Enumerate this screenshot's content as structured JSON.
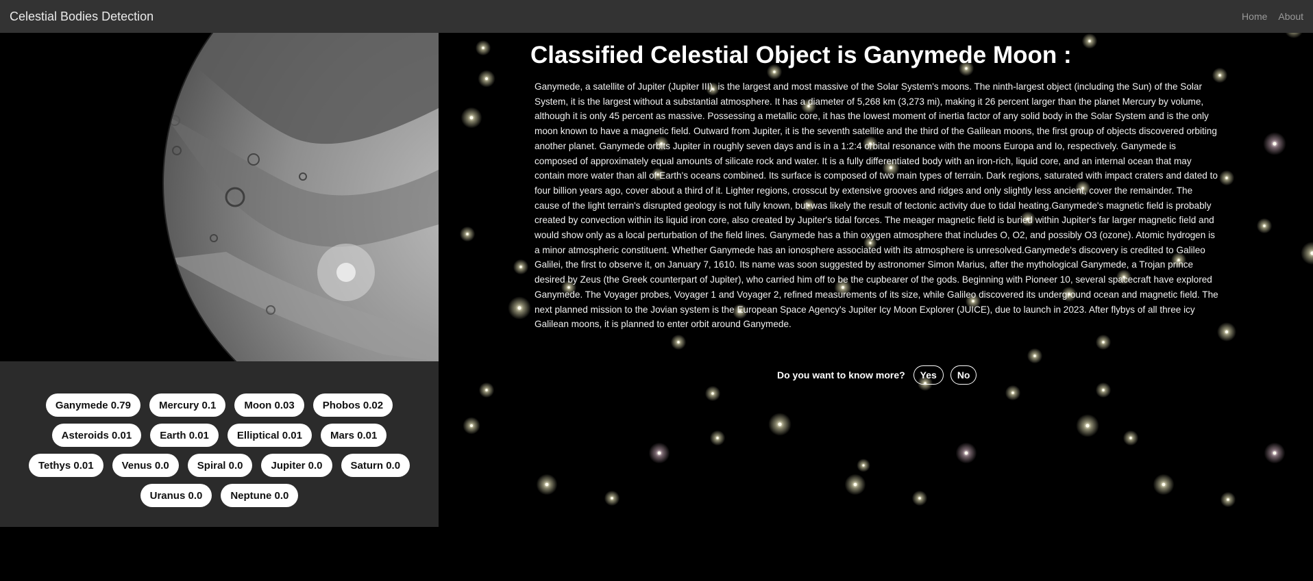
{
  "nav": {
    "brand": "Celestial Bodies Detection",
    "links": [
      "Home",
      "About"
    ]
  },
  "photo": {
    "subject": "Ganymede"
  },
  "predictions": [
    {
      "label": "Ganymede 0.79"
    },
    {
      "label": "Mercury 0.1"
    },
    {
      "label": "Moon 0.03"
    },
    {
      "label": "Phobos 0.02"
    },
    {
      "label": "Asteroids 0.01"
    },
    {
      "label": "Earth 0.01"
    },
    {
      "label": "Elliptical 0.01"
    },
    {
      "label": "Mars 0.01"
    },
    {
      "label": "Tethys 0.01"
    },
    {
      "label": "Venus 0.0"
    },
    {
      "label": "Spiral 0.0"
    },
    {
      "label": "Jupiter 0.0"
    },
    {
      "label": "Saturn 0.0"
    },
    {
      "label": "Uranus 0.0"
    },
    {
      "label": "Neptune 0.0"
    }
  ],
  "result": {
    "title": "Classified Celestial Object is Ganymede Moon :",
    "description": "Ganymede, a satellite of Jupiter (Jupiter III), is the largest and most massive of the Solar System's moons. The ninth-largest object (including the Sun) of the Solar System, it is the largest without a substantial atmosphere. It has a diameter of 5,268 km (3,273 mi), making it 26 percent larger than the planet Mercury by volume, although it is only 45 percent as massive. Possessing a metallic core, it has the lowest moment of inertia factor of any solid body in the Solar System and is the only moon known to have a magnetic field. Outward from Jupiter, it is the seventh satellite and the third of the Galilean moons, the first group of objects discovered orbiting another planet. Ganymede orbits Jupiter in roughly seven days and is in a 1:2:4 orbital resonance with the moons Europa and Io, respectively. Ganymede is composed of approximately equal amounts of silicate rock and water. It is a fully differentiated body with an iron-rich, liquid core, and an internal ocean that may contain more water than all of Earth's oceans combined. Its surface is composed of two main types of terrain. Dark regions, saturated with impact craters and dated to four billion years ago, cover about a third of it. Lighter regions, crosscut by extensive grooves and ridges and only slightly less ancient, cover the remainder. The cause of the light terrain's disrupted geology is not fully known, but was likely the result of tectonic activity due to tidal heating.Ganymede's magnetic field is probably created by convection within its liquid iron core, also created by Jupiter's tidal forces. The meager magnetic field is buried within Jupiter's far larger magnetic field and would show only as a local perturbation of the field lines. Ganymede has a thin oxygen atmosphere that includes O, O2, and possibly O3 (ozone). Atomic hydrogen is a minor atmospheric constituent. Whether Ganymede has an ionosphere associated with its atmosphere is unresolved.Ganymede's discovery is credited to Galileo Galilei, the first to observe it, on January 7, 1610. Its name was soon suggested by astronomer Simon Marius, after the mythological Ganymede, a Trojan prince desired by Zeus (the Greek counterpart of Jupiter), who carried him off to be the cupbearer of the gods. Beginning with Pioneer 10, several spacecraft have explored Ganymede. The Voyager probes, Voyager 1 and Voyager 2, refined measurements of its size, while Galileo discovered its underground ocean and magnetic field. The next planned mission to the Jovian system is the European Space Agency's Jupiter Icy Moon Explorer (JUICE), due to launch in 2023. After flybys of all three icy Galilean moons, it is planned to enter orbit around Ganymede."
  },
  "prompt": {
    "question": "Do you want to know more?",
    "yes": "Yes",
    "no": "No"
  },
  "colors": {
    "navbar": "#333333",
    "panel": "#2b2b2b",
    "background": "#000000",
    "chip": "#ffffff",
    "star": "#f3f0c8"
  }
}
